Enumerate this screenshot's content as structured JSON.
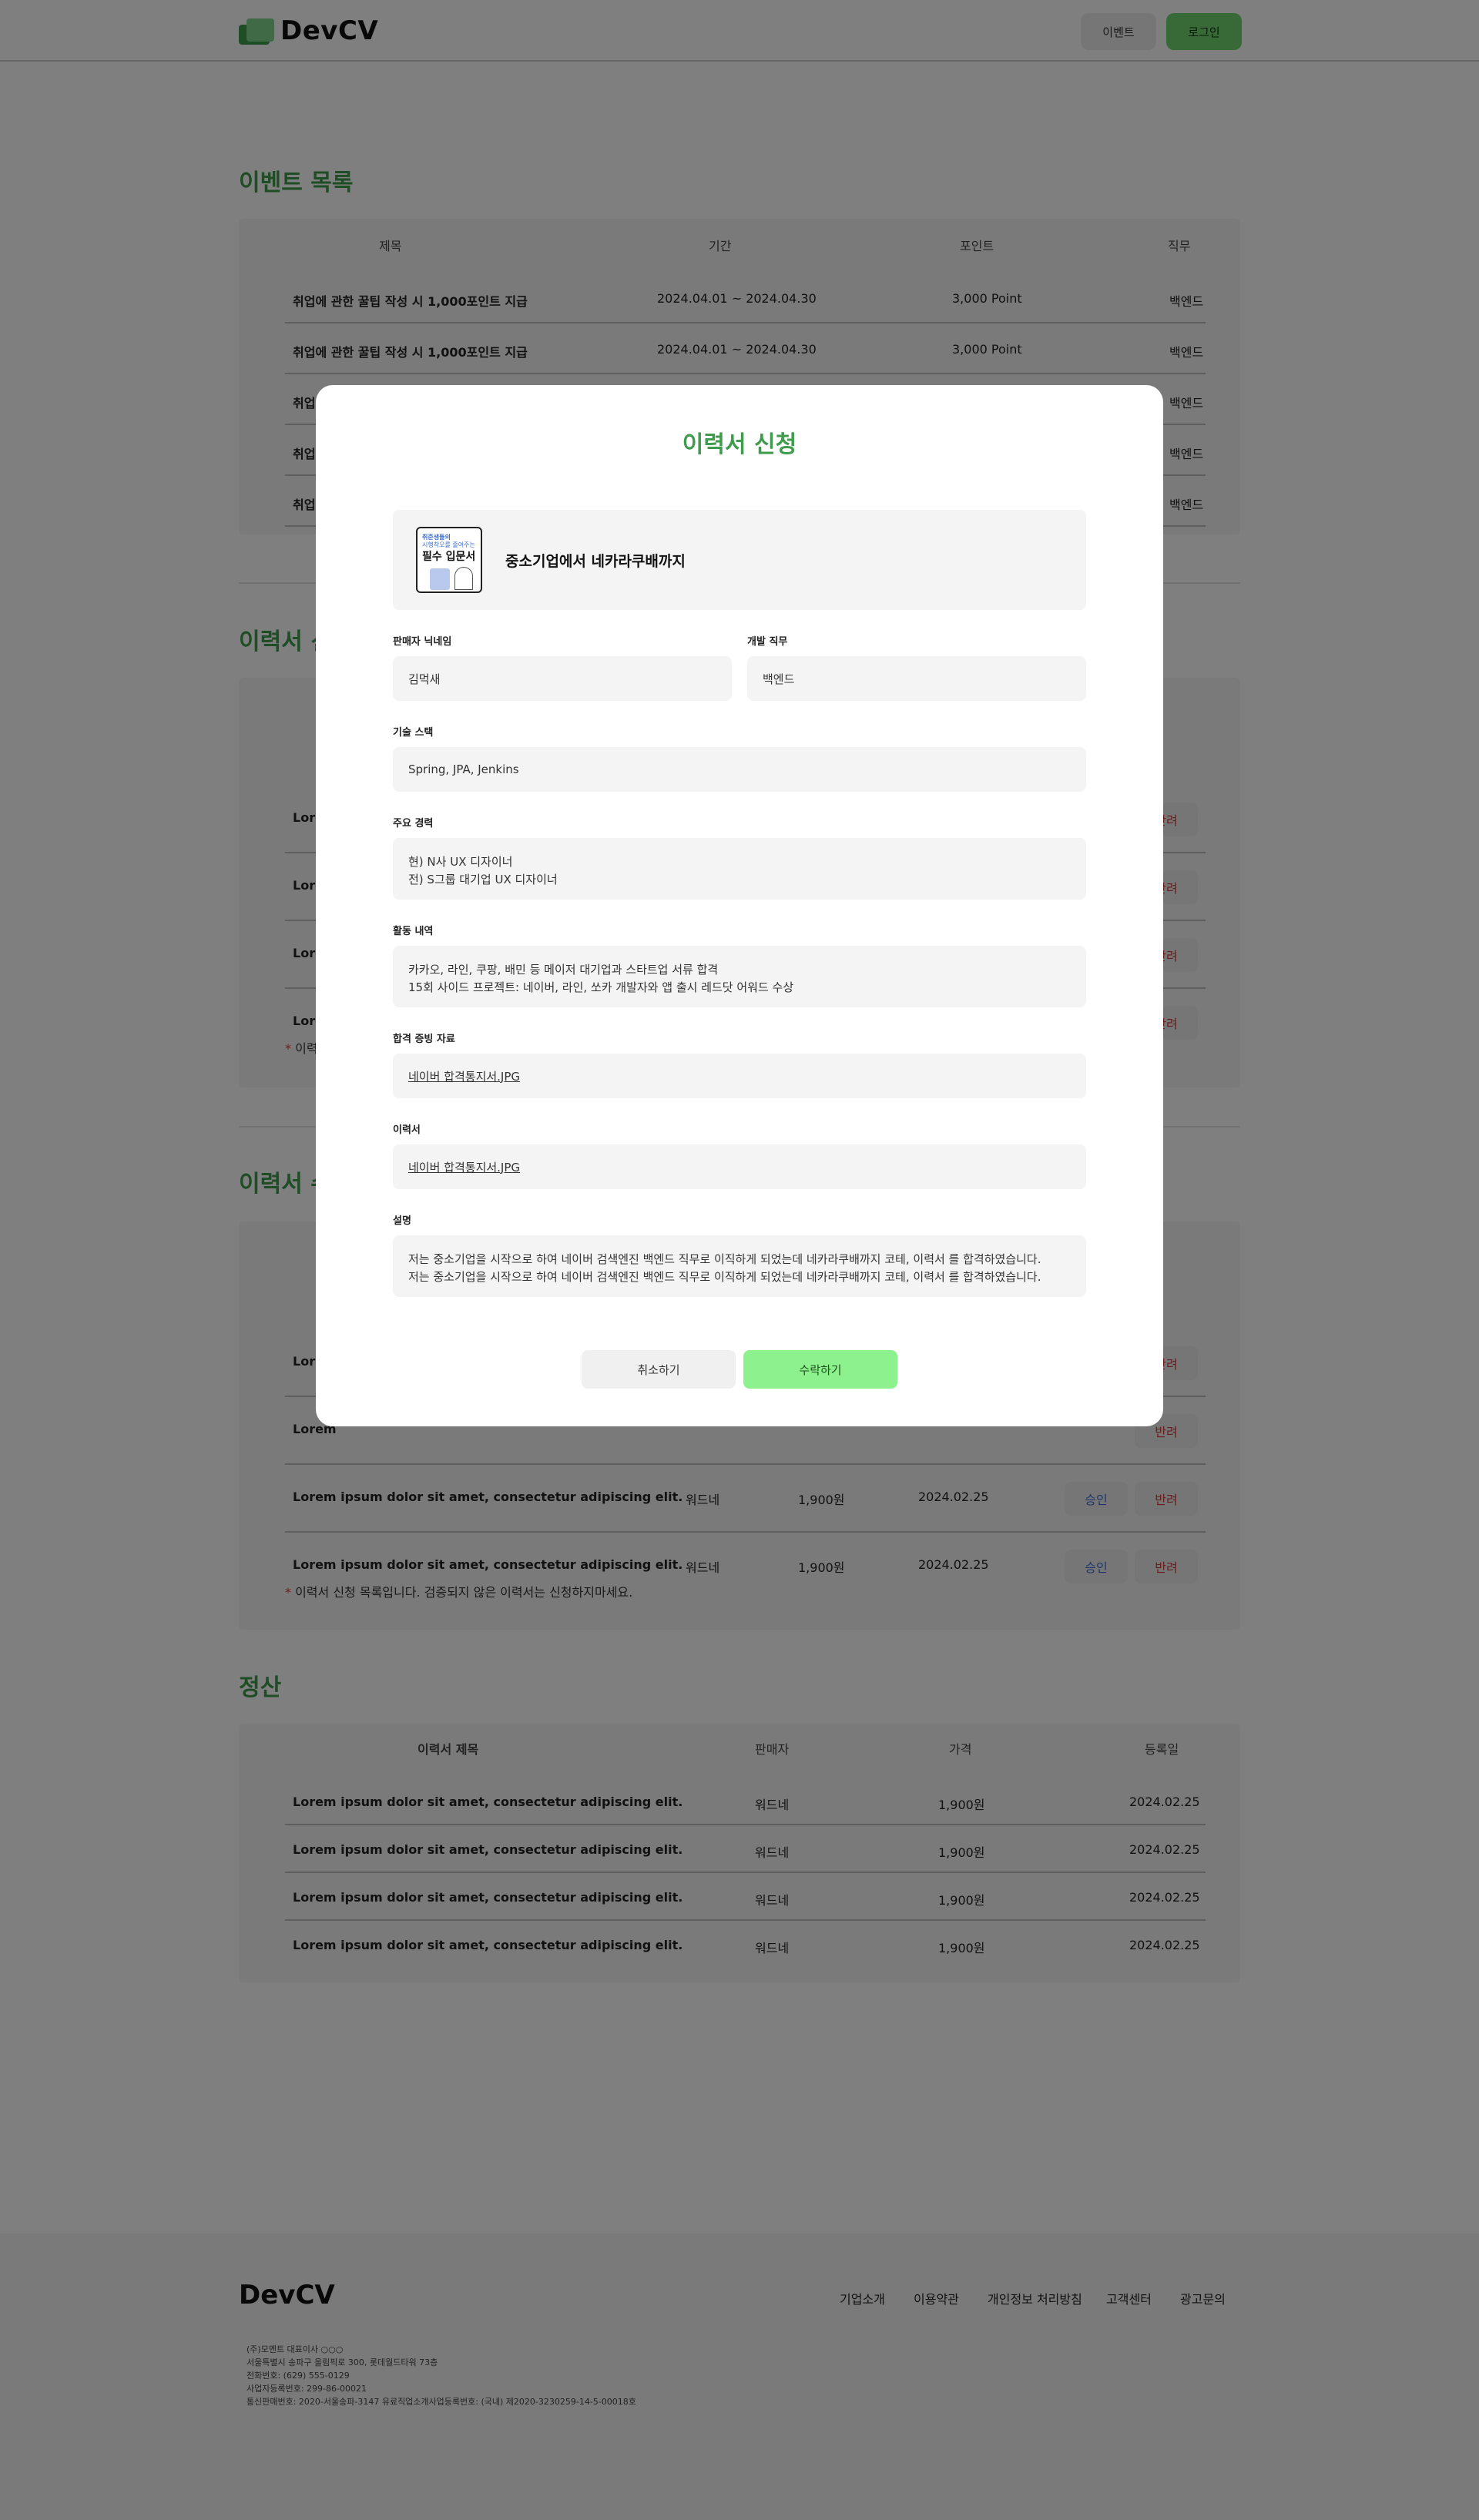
{
  "header": {
    "logo": "DevCV",
    "event_button": "이벤트",
    "login_button": "로그인"
  },
  "events": {
    "title": "이벤트 목록",
    "columns": [
      "제목",
      "기간",
      "포인트",
      "직무"
    ],
    "rows": [
      [
        "취업에 관한 꿀팁 작성 시 1,000포인트 지급",
        "2024.04.01 ~ 2024.04.30",
        "3,000 Point",
        "백엔드"
      ],
      [
        "취업에 관한 꿀팁 작성 시 1,000포인트 지급",
        "2024.04.01 ~ 2024.04.30",
        "3,000 Point",
        "백엔드"
      ],
      [
        "취업에",
        "",
        "",
        "백엔드"
      ],
      [
        "취업에",
        "",
        "",
        "백엔드"
      ],
      [
        "취업에",
        "",
        "",
        "백엔드"
      ]
    ]
  },
  "applications": {
    "title": "이력서 신",
    "rows": [
      {
        "title": "Lorem",
        "reject": "반려"
      },
      {
        "title": "Lorem",
        "reject": "반려"
      },
      {
        "title": "Lorem",
        "reject": "반려"
      },
      {
        "title": "Lorem",
        "reject": "반려"
      }
    ],
    "note": "이력"
  },
  "received": {
    "title": "이력서 수",
    "rows": [
      {
        "title": "Lorem",
        "seller": "",
        "price": "",
        "date": "",
        "approve": "",
        "reject": "반려"
      },
      {
        "title": "Lorem",
        "seller": "",
        "price": "",
        "date": "",
        "approve": "",
        "reject": "반려"
      },
      {
        "title": "Lorem ipsum dolor sit amet, consectetur adipiscing elit.",
        "seller": "워드네",
        "price": "1,900원",
        "date": "2024.02.25",
        "approve": "승인",
        "reject": "반려"
      },
      {
        "title": "Lorem ipsum dolor sit amet, consectetur adipiscing elit.",
        "seller": "워드네",
        "price": "1,900원",
        "date": "2024.02.25",
        "approve": "승인",
        "reject": "반려"
      }
    ],
    "note_star": "*",
    "note": " 이력서 신청 목록입니다. 검증되지 않은 이력서는 신청하지마세요."
  },
  "settlement": {
    "title": "정산",
    "columns": [
      "이력서 제목",
      "판매자",
      "가격",
      "등록일"
    ],
    "rows": [
      [
        "Lorem ipsum dolor sit amet, consectetur adipiscing elit.",
        "워드네",
        "1,900원",
        "2024.02.25"
      ],
      [
        "Lorem ipsum dolor sit amet, consectetur adipiscing elit.",
        "워드네",
        "1,900원",
        "2024.02.25"
      ],
      [
        "Lorem ipsum dolor sit amet, consectetur adipiscing elit.",
        "워드네",
        "1,900원",
        "2024.02.25"
      ],
      [
        "Lorem ipsum dolor sit amet, consectetur adipiscing elit.",
        "워드네",
        "1,900원",
        "2024.02.25"
      ]
    ]
  },
  "footer": {
    "logo": "DevCV",
    "links": [
      "기업소개",
      "이용약관",
      "개인정보 처리방침",
      "고객센터",
      "광고문의"
    ],
    "info": [
      "(주)모멘트   대표이사 ○○○",
      "서울특별시 송파구 올림픽로 300, 롯데월드타워 73층",
      "전화번호: (629) 555-0129",
      "사업자등록번호: 299-86-00021",
      "통신판매번호: 2020-서울송파-3147   유료직업소개사업등록번호: (국내) 제2020-3230259-14-5-00018호"
    ]
  },
  "modal": {
    "title": "이력서 신청",
    "book": {
      "title": "중소기업에서 네카라쿠배까지",
      "thumb_line1": "취준생들의",
      "thumb_line2": "시행착오를 줄여주는",
      "thumb_line3": "필수 입문서"
    },
    "seller_label": "판매자 닉네임",
    "seller_value": "김먹새",
    "job_label": "개발 직무",
    "job_value": "백엔드",
    "stack_label": "기술 스택",
    "stack_value": "Spring, JPA, Jenkins",
    "career_label": "주요 경력",
    "career_lines": [
      "현) N사 UX 디자이너",
      "전) S그룹 대기업 UX 디자이너"
    ],
    "activity_label": "활동 내역",
    "activity_lines": [
      "카카오, 라인, 쿠팡, 배민 등 메이저 대기업과 스타트업 서류 합격",
      "15회 사이드 프로젝트: 네이버, 라인, 쏘카 개발자와 앱 출시 레드닷 어워드 수상"
    ],
    "proof_label": "합격 증빙 자료",
    "proof_file": "네이버 합격통지서.JPG",
    "resume_label": "이력서",
    "resume_file": "네이버 합격통지서.JPG",
    "desc_label": "설명",
    "desc_lines": [
      "저는 중소기업을 시작으로 하여 네이버 검색엔진 백엔드 직무로 이직하게 되었는데 네카라쿠배까지 코테, 이력서 를 합격하였습니다.",
      "저는 중소기업을 시작으로 하여 네이버 검색엔진 백엔드 직무로 이직하게 되었는데 네카라쿠배까지 코테, 이력서 를 합격하였습니다."
    ],
    "cancel_button": "취소하기",
    "accept_button": "수락하기"
  }
}
